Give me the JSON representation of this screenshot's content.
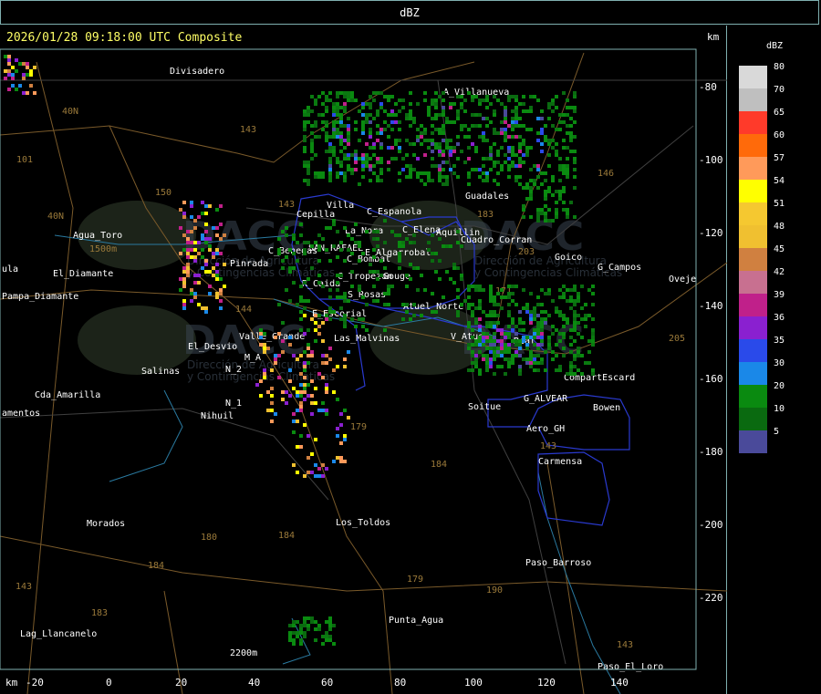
{
  "header": {
    "title": "dBZ"
  },
  "map": {
    "timestamp": "2026/01/28 09:18:00 UTC Composite",
    "km_top": "km",
    "km_bottom": "km",
    "y_ticks": [
      "-80",
      "-100",
      "-120",
      "-140",
      "-160",
      "-180",
      "-200",
      "-220"
    ],
    "x_ticks": [
      "-20",
      "0",
      "20",
      "40",
      "60",
      "80",
      "100",
      "120",
      "140"
    ],
    "places": [
      "Divisadero",
      "A_Villanueva",
      "Guadales",
      "Agua_Toro",
      "G_Campos",
      "Goico",
      "Oveje",
      "Pampa_Diamante",
      "ula",
      "El_Desvio",
      "Salinas",
      "Cda_Amarilla",
      "amentos",
      "Nihuil",
      "Morados",
      "Lag_Llancanelo",
      "Los_Toldos",
      "Punta_Agua",
      "Paso_Barroso",
      "Paso_El_Loro",
      "Carmensa",
      "Aero_GH",
      "Bowen",
      "Soitue",
      "G_ALVEAR",
      "CompartEscard",
      "V_Atuel",
      "Real",
      "Las_Malvinas",
      "Atuel_Norte",
      "S_Rosas",
      "R_Caida",
      "C_Tropezon",
      "Gouge",
      "C_Bombal",
      "E_Algarrobal",
      "SAN_RAFAEL",
      "C_Benegas",
      "Pinrada",
      "E_Escorial",
      "Valle_Grande",
      "N_2",
      "N_1",
      "La_Nora",
      "C_Espanola",
      "C_Elena",
      "Cuadro_Corran",
      "Cepilla",
      "Villa",
      "Aquillin",
      "El_Diamante",
      "M_A"
    ],
    "road_numbers": [
      "143",
      "101",
      "40N",
      "150",
      "40N",
      "144",
      "143",
      "146",
      "171",
      "183",
      "203",
      "205",
      "179",
      "184",
      "143",
      "180",
      "184",
      "179",
      "190",
      "184",
      "183",
      "143",
      "143"
    ],
    "watermark": {
      "text": "DACC",
      "subtitle_1": "Dirección de Agricultura",
      "subtitle_2": "y Contingencias Climáticas"
    },
    "radar_range_label": "2200m",
    "agua_toro_alt": "1500m"
  },
  "legend": {
    "title": "dBZ",
    "items": [
      {
        "label": "80",
        "color": "#d9d9d9"
      },
      {
        "label": "70",
        "color": "#bfbfbf"
      },
      {
        "label": "65",
        "color": "#ff3a2a"
      },
      {
        "label": "60",
        "color": "#ff6a0a"
      },
      {
        "label": "57",
        "color": "#ff9a5a"
      },
      {
        "label": "54",
        "color": "#ffff00"
      },
      {
        "label": "51",
        "color": "#f5c830"
      },
      {
        "label": "48",
        "color": "#f0c030"
      },
      {
        "label": "45",
        "color": "#d08040"
      },
      {
        "label": "42",
        "color": "#c87090"
      },
      {
        "label": "39",
        "color": "#c0208a"
      },
      {
        "label": "36",
        "color": "#8a20d0"
      },
      {
        "label": "35",
        "color": "#2a4aea"
      },
      {
        "label": "30",
        "color": "#1a88e8"
      },
      {
        "label": "20",
        "color": "#0a8a10"
      },
      {
        "label": "10",
        "color": "#0a6a10"
      },
      {
        "label": "5",
        "color": "#4a4a9a"
      }
    ]
  }
}
